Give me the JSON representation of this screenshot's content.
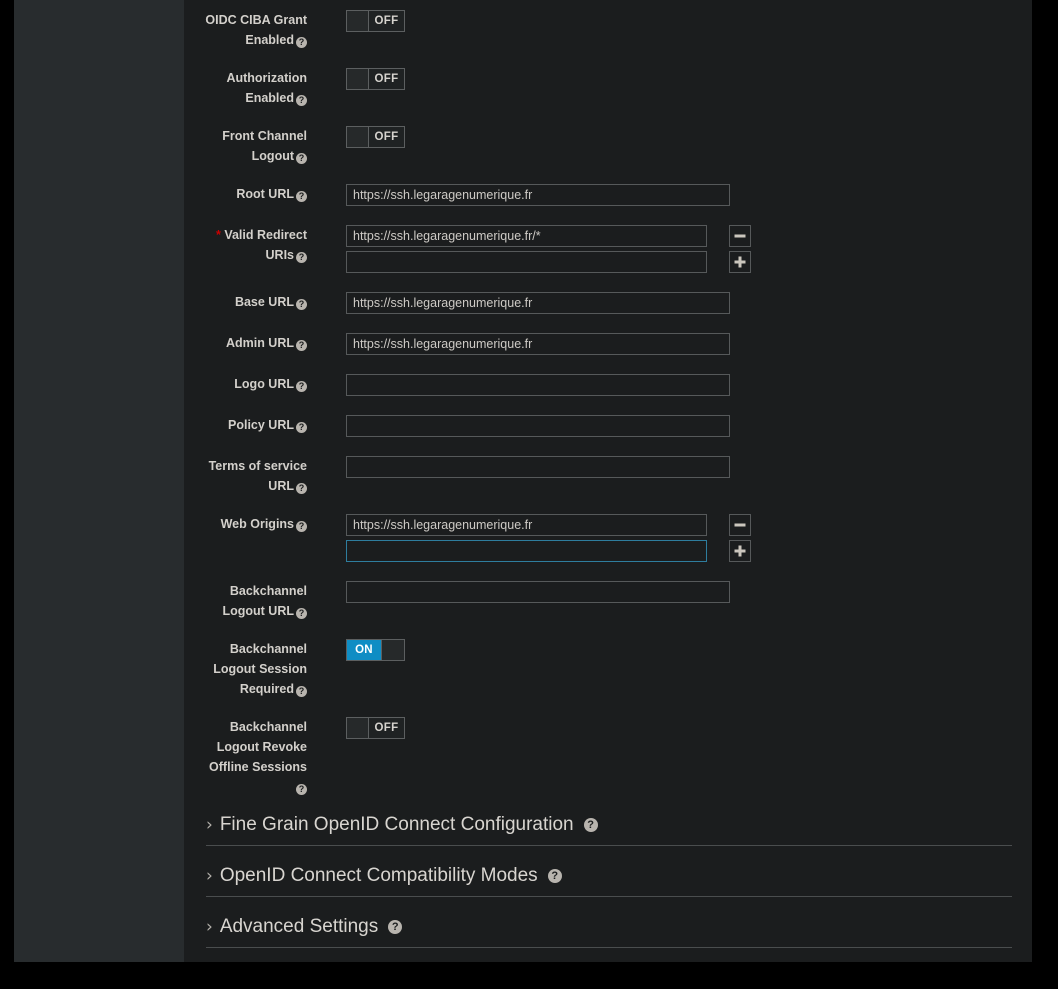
{
  "theme": {
    "page_background": "#000000",
    "sidebar_background": "#282c2e",
    "content_background": "#1b1d1e",
    "label_color": "#d3d0cb",
    "input_border": "#56595a",
    "input_text": "#cdcac5",
    "focus_border": "#2e7d9e",
    "switch_on_color": "#0f8dc4",
    "required_asterisk_color": "#cc0000",
    "section_rule_color": "#4a4d4e"
  },
  "form": {
    "fields": [
      {
        "id": "oidc-ciba-grant-enabled",
        "label": "OIDC CIBA Grant Enabled",
        "label_lines": [
          "OIDC CIBA Grant",
          "Enabled"
        ],
        "type": "switch",
        "state": "OFF",
        "required": false,
        "help": "help-icon"
      },
      {
        "id": "authorization-enabled",
        "label": "Authorization Enabled",
        "label_lines": [
          "Authorization",
          "Enabled"
        ],
        "type": "switch",
        "state": "OFF",
        "required": false,
        "help": "help-icon"
      },
      {
        "id": "front-channel-logout",
        "label": "Front Channel Logout",
        "label_lines": [
          "Front Channel",
          "Logout"
        ],
        "type": "switch",
        "state": "OFF",
        "required": false,
        "help": "help-icon"
      },
      {
        "id": "root-url",
        "label": "Root URL",
        "label_lines": [
          "Root URL"
        ],
        "type": "text",
        "value": "https://ssh.legaragenumerique.fr",
        "placeholder": "",
        "required": false,
        "help": "help-icon"
      },
      {
        "id": "valid-redirect-uris",
        "label": "Valid Redirect URIs",
        "label_lines": [
          "Valid Redirect",
          "URIs"
        ],
        "type": "multi-text",
        "required": true,
        "help": "help-icon",
        "entries": [
          {
            "value": "https://ssh.legaragenumerique.fr/*",
            "button": "remove",
            "focused": false
          },
          {
            "value": "",
            "button": "add",
            "focused": false
          }
        ]
      },
      {
        "id": "base-url",
        "label": "Base URL",
        "label_lines": [
          "Base URL"
        ],
        "type": "text",
        "value": "https://ssh.legaragenumerique.fr",
        "placeholder": "",
        "required": false,
        "help": "help-icon"
      },
      {
        "id": "admin-url",
        "label": "Admin URL",
        "label_lines": [
          "Admin URL"
        ],
        "type": "text",
        "value": "https://ssh.legaragenumerique.fr",
        "placeholder": "",
        "required": false,
        "help": "help-icon"
      },
      {
        "id": "logo-url",
        "label": "Logo URL",
        "label_lines": [
          "Logo URL"
        ],
        "type": "text",
        "value": "",
        "placeholder": "",
        "required": false,
        "help": "help-icon"
      },
      {
        "id": "policy-url",
        "label": "Policy URL",
        "label_lines": [
          "Policy URL"
        ],
        "type": "text",
        "value": "",
        "placeholder": "",
        "required": false,
        "help": "help-icon"
      },
      {
        "id": "terms-of-service-url",
        "label": "Terms of service URL",
        "label_lines": [
          "Terms of service",
          "URL"
        ],
        "type": "text",
        "value": "",
        "placeholder": "",
        "required": false,
        "help": "help-icon"
      },
      {
        "id": "web-origins",
        "label": "Web Origins",
        "label_lines": [
          "Web Origins"
        ],
        "type": "multi-text",
        "required": false,
        "help": "help-icon",
        "entries": [
          {
            "value": "https://ssh.legaragenumerique.fr",
            "button": "remove",
            "focused": false
          },
          {
            "value": "",
            "button": "add",
            "focused": true
          }
        ]
      },
      {
        "id": "backchannel-logout-url",
        "label": "Backchannel Logout URL",
        "label_lines": [
          "Backchannel",
          "Logout URL"
        ],
        "type": "text",
        "value": "",
        "placeholder": "",
        "required": false,
        "help": "help-icon"
      },
      {
        "id": "backchannel-logout-session-required",
        "label": "Backchannel Logout Session Required",
        "label_lines": [
          "Backchannel",
          "Logout Session",
          "Required"
        ],
        "type": "switch",
        "state": "ON",
        "required": false,
        "help": "help-icon"
      },
      {
        "id": "backchannel-logout-revoke-offline-sessions",
        "label": "Backchannel Logout Revoke Offline Sessions",
        "label_lines": [
          "Backchannel",
          "Logout Revoke",
          "Offline Sessions",
          ""
        ],
        "type": "switch",
        "state": "OFF",
        "required": false,
        "help": "help-icon"
      }
    ]
  },
  "sections": [
    {
      "id": "fine-grain-openid-connect-configuration",
      "title": "Fine Grain OpenID Connect Configuration",
      "expanded": false,
      "chevron": "chevron-right-icon",
      "help": "help-icon"
    },
    {
      "id": "openid-connect-compatibility-modes",
      "title": "OpenID Connect Compatibility Modes",
      "expanded": false,
      "chevron": "chevron-right-icon",
      "help": "help-icon"
    },
    {
      "id": "advanced-settings",
      "title": "Advanced Settings",
      "expanded": false,
      "chevron": "chevron-right-icon",
      "help": "help-icon"
    }
  ],
  "glyphs": {
    "help": "?",
    "chevron_right": "›",
    "remove": "−",
    "add": "+"
  }
}
